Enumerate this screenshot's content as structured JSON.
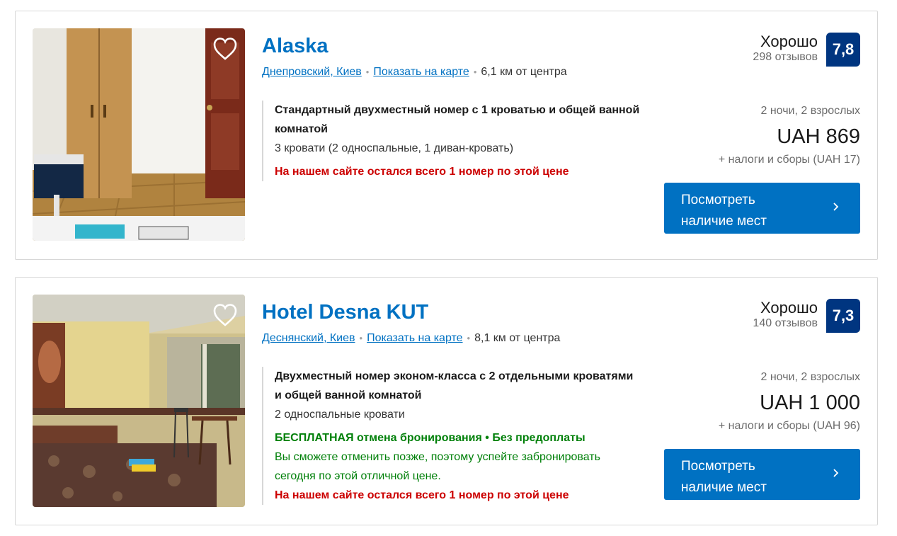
{
  "listings": [
    {
      "name": "Alaska",
      "district": "Днепровский, Киев",
      "map_link": "Показать на карте",
      "distance": "6,1 км от центра",
      "room_name": "Стандартный двухместный номер с 1 кроватью и общей ванной комнатой",
      "beds": "3 кровати (2 односпальные, 1 диван-кровать)",
      "scarcity": "На нашем сайте остался всего 1 номер по этой цене",
      "rating_word": "Хорошо",
      "review_count": "298 отзывов",
      "score": "7,8",
      "stay_info": "2 ночи, 2 взрослых",
      "price": "UAH 869",
      "taxes": "+ налоги и сборы (UAH 17)",
      "button_line1": "Посмотреть",
      "button_line2": "наличие мест"
    },
    {
      "name": "Hotel Desna KUT",
      "district": "Деснянский, Киев",
      "map_link": "Показать на карте",
      "distance": "8,1 км от центра",
      "room_name": "Двухместный номер эконом-класса с 2 отдельными кроватями и общей ванной комнатой",
      "beds": "2 односпальные кровати",
      "cancellation": "БЕСПЛАТНАЯ отмена бронирования • Без предоплаты",
      "cancellation_note": "Вы сможете отменить позже, поэтому успейте забронировать сегодня по этой отличной цене.",
      "scarcity": "На нашем сайте остался всего 1 номер по этой цене",
      "rating_word": "Хорошо",
      "review_count": "140 отзывов",
      "score": "7,3",
      "stay_info": "2 ночи, 2 взрослых",
      "price": "UAH 1 000",
      "taxes": "+ налоги и сборы (UAH 96)",
      "button_line1": "Посмотреть",
      "button_line2": "наличие мест"
    }
  ],
  "icons": {
    "favorite": "heart-outline-icon",
    "chevron": "chevron-right-icon"
  },
  "colors": {
    "link": "#0071c2",
    "score_bg": "#003580",
    "button": "#0071c2",
    "warning": "#cc0000",
    "free_cancel": "#008009"
  }
}
